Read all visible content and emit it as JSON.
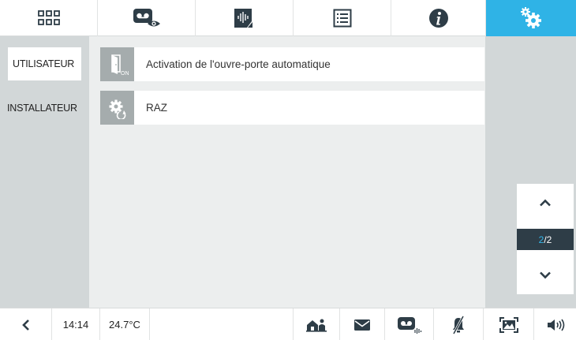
{
  "colors": {
    "accent": "#2fb3e6",
    "icon_dark": "#2e3d47",
    "sidebar_bg": "#d2d7d8",
    "row_icon_bg": "#a5acad"
  },
  "top_tabs": [
    {
      "name": "home-grid",
      "icon": "grid-icon",
      "active": false
    },
    {
      "name": "video-memo",
      "icon": "videomail-view-icon",
      "active": false
    },
    {
      "name": "audio-memo",
      "icon": "audio-memo-icon",
      "active": false
    },
    {
      "name": "list",
      "icon": "list-icon",
      "active": false
    },
    {
      "name": "info",
      "icon": "info-icon",
      "active": false
    },
    {
      "name": "settings",
      "icon": "settings-gears-icon",
      "active": true
    }
  ],
  "sidebar": {
    "items": [
      {
        "label": "UTILISATEUR",
        "selected": true
      },
      {
        "label": "INSTALLATEUR",
        "selected": false
      }
    ]
  },
  "list": {
    "items": [
      {
        "icon": "door-open-on-icon",
        "badge": "ON",
        "label": "Activation de l'ouvre-porte automatique"
      },
      {
        "icon": "gear-reset-icon",
        "label": "RAZ"
      }
    ]
  },
  "pager": {
    "current": "2",
    "separator": "/",
    "total": "2"
  },
  "status_bar": {
    "time": "14:14",
    "temperature": "24.7°C",
    "icons": [
      "back-arrow-icon",
      "home-people-icon",
      "mail-icon",
      "videomail-icon",
      "mute-bell-icon",
      "picture-frame-icon",
      "speaker-icon"
    ]
  }
}
